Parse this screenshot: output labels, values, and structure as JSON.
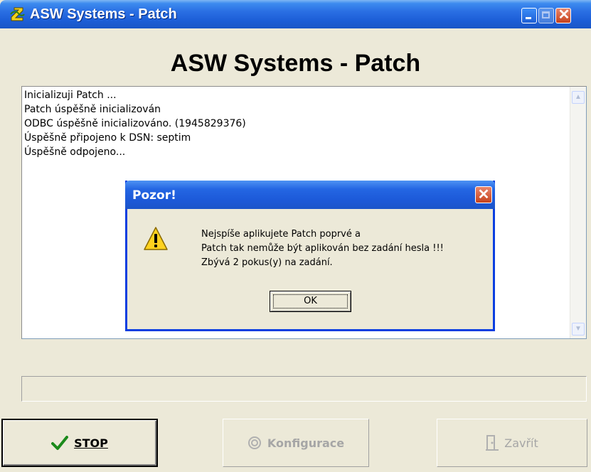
{
  "window": {
    "title": "ASW Systems  -  Patch",
    "icon": "app-logo-icon",
    "controls": [
      "minimize",
      "maximize",
      "close"
    ]
  },
  "app_title": "ASW Systems  -  Patch",
  "log": {
    "lines": [
      "Inicializuji Patch ...",
      "Patch úspěšně inicializován",
      "ODBC úspěšně inicializováno. (1945829376)",
      "Úspěšně připojeno k DSN: septim",
      "Úspěšně odpojeno..."
    ]
  },
  "buttons": {
    "stop": {
      "label": "STOP",
      "icon": "checkmark-icon",
      "enabled": true
    },
    "config": {
      "label": "Konfigurace",
      "icon": "gear-icon",
      "enabled": false
    },
    "close": {
      "label": "Zavřít",
      "icon": "door-icon",
      "enabled": false
    }
  },
  "dialog": {
    "title": "Pozor!",
    "icon": "warning-icon",
    "message": [
      "Nejspíše aplikujete Patch poprvé a",
      "Patch tak nemůže být aplikován bez zadání hesla !!!",
      "Zbývá 2 pokus(y) na zadání."
    ],
    "ok_label": "OK"
  },
  "colors": {
    "titlebar": "#1d5fd8",
    "window_bg": "#ece9d8",
    "close_button": "#c6421c",
    "disabled_text": "#a6a6a6"
  }
}
